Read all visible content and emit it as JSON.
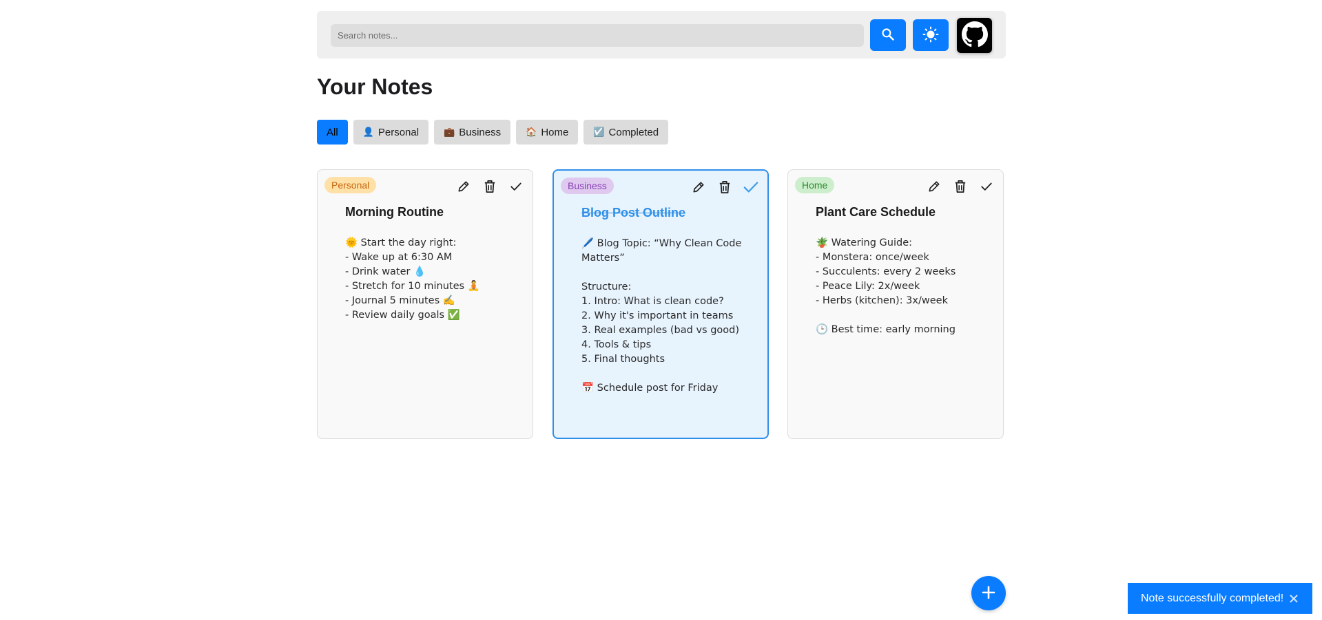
{
  "search": {
    "placeholder": "Search notes..."
  },
  "header": {
    "title": "Your Notes"
  },
  "filters": [
    {
      "label": "All",
      "icon": ""
    },
    {
      "label": "Personal",
      "icon": "👤"
    },
    {
      "label": "Business",
      "icon": "💼"
    },
    {
      "label": "Home",
      "icon": "🏠"
    },
    {
      "label": "Completed",
      "icon": "☑️"
    }
  ],
  "notes": [
    {
      "tag": "Personal",
      "tag_bg": "#ffe1a8",
      "tag_color": "#c7660e",
      "title": "Morning Routine",
      "body": "🌞 Start the day right:\n- Wake up at 6:30 AM\n- Drink water 💧\n- Stretch for 10 minutes 🧘\n- Journal 5 minutes ✍️\n- Review daily goals ✅",
      "completed": false
    },
    {
      "tag": "Business",
      "tag_bg": "#dfc9ef",
      "tag_color": "#8a43b5",
      "title": "Blog Post Outline",
      "body": "🖊️ Blog Topic: “Why Clean Code Matters”\n\nStructure:\n1. Intro: What is clean code?\n2. Why it's important in teams\n3. Real examples (bad vs good)\n4. Tools & tips\n5. Final thoughts\n\n📅 Schedule post for Friday",
      "completed": true
    },
    {
      "tag": "Home",
      "tag_bg": "#cdeecd",
      "tag_color": "#2f8a2f",
      "title": "Plant Care Schedule",
      "body": "🪴 Watering Guide:\n- Monstera: once/week\n- Succulents: every 2 weeks\n- Peace Lily: 2x/week\n- Herbs (kitchen): 3x/week\n\n🕒 Best time: early morning",
      "completed": false
    }
  ],
  "toast": {
    "message": "Note successfully completed!"
  },
  "colors": {
    "accent": "#0a7cff",
    "completed_border": "#2f8fe8",
    "completed_bg": "#e7f3fd"
  }
}
